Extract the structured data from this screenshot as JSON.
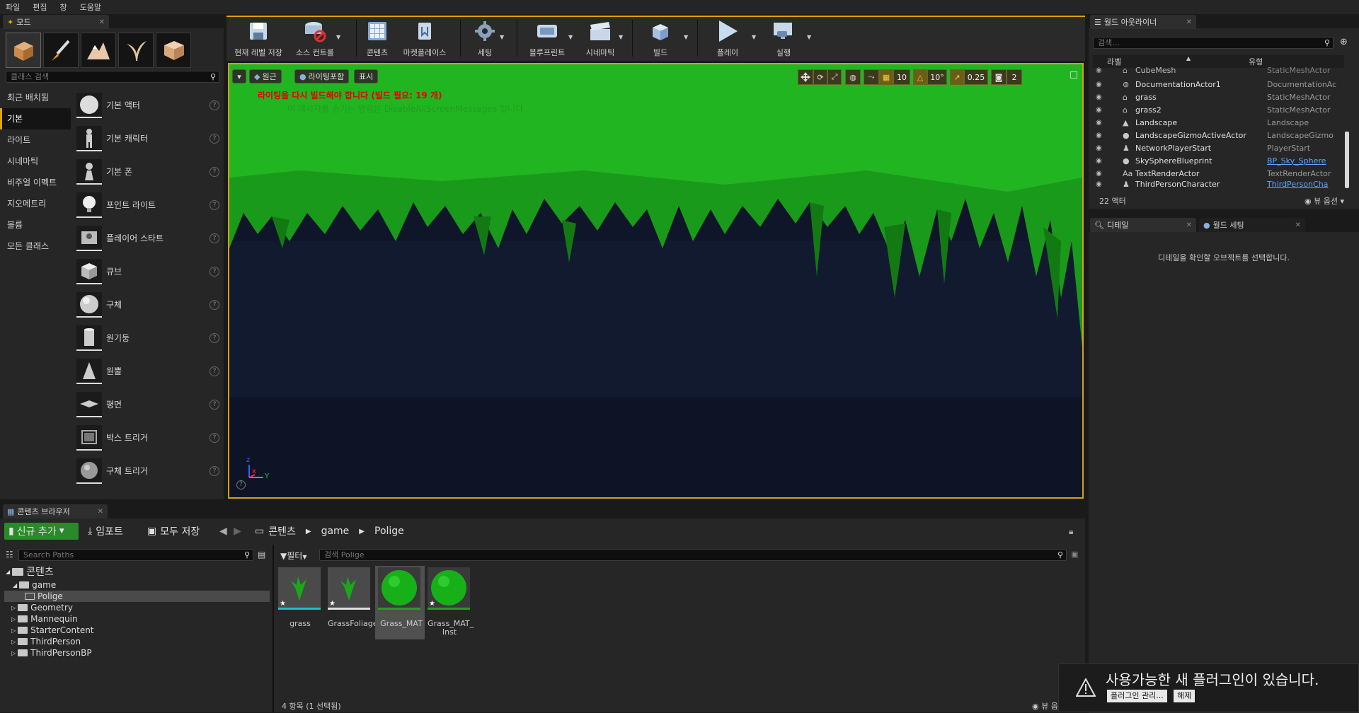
{
  "menu": [
    "파일",
    "편집",
    "창",
    "도움말"
  ],
  "modes": {
    "tab_title": "모드",
    "search_placeholder": "클래스 검색",
    "categories": [
      "최근 배치됨",
      "기본",
      "라이트",
      "시네마틱",
      "비주얼 이펙트",
      "지오메트리",
      "볼륨",
      "모든 클래스"
    ],
    "items": [
      "기본 액터",
      "기본 캐릭터",
      "기본 폰",
      "포인트 라이트",
      "플레이어 스타트",
      "큐브",
      "구체",
      "원기둥",
      "원뿔",
      "평면",
      "박스 트리거",
      "구체 트리거"
    ],
    "help_glyph": "?"
  },
  "toolbar": {
    "save": "현재 레벨 저장",
    "source_control": "소스 컨트롤",
    "content": "콘텐츠",
    "marketplace": "마켓플레이스",
    "settings": "세팅",
    "blueprint": "블루프린트",
    "cinematic": "시네마틱",
    "build": "빌드",
    "play": "플레이",
    "launch": "실행"
  },
  "viewport": {
    "perspective": "원근",
    "lighting": "라이팅포함",
    "show": "표시",
    "warning": "라이팅을 다시 빌드해야 합니다 (빌드 필요: 19 개)",
    "sub_warning": "이 메시지를 숨기는 명령은 DisableAllScreenMessages 입니다.",
    "grid_snap": "10",
    "rot_snap": "10°",
    "scale_snap": "0.25",
    "camera_speed": "2",
    "axis_x": "x",
    "axis_y": "Y",
    "axis_z": "z"
  },
  "outliner": {
    "tab_title": "월드 아웃라이너",
    "search_placeholder": "검색...",
    "col_label": "라벨",
    "col_type": "유형",
    "rows": [
      {
        "name": "CubeMesh",
        "type": "StaticMeshActor"
      },
      {
        "name": "DocumentationActor1",
        "type": "DocumentationAc"
      },
      {
        "name": "grass",
        "type": "StaticMeshActor"
      },
      {
        "name": "grass2",
        "type": "StaticMeshActor"
      },
      {
        "name": "Landscape",
        "type": "Landscape"
      },
      {
        "name": "LandscapeGizmoActiveActor",
        "type": "LandscapeGizmo"
      },
      {
        "name": "NetworkPlayerStart",
        "type": "PlayerStart"
      },
      {
        "name": "SkySphereBlueprint",
        "type": "BP_Sky_Sphere"
      },
      {
        "name": "TextRenderActor",
        "type": "TextRenderActor"
      },
      {
        "name": "ThirdPersonCharacter",
        "type": "ThirdPersonCha"
      }
    ],
    "count": "22 액터",
    "view_options": "뷰 옵션"
  },
  "details": {
    "tab_details": "디테일",
    "tab_world": "월드 세팅",
    "empty": "디테일을 확인할 오브젝트를 선택합니다."
  },
  "content_browser": {
    "tab_title": "콘텐츠 브라우저",
    "add_new": "신규 추가",
    "import": "임포트",
    "save_all": "모두 저장",
    "path": [
      "콘텐츠",
      "game",
      "Polige"
    ],
    "search_paths": "Search Paths",
    "filter": "필터",
    "search_assets": "검색 Polige",
    "tree_root": "콘텐츠",
    "tree": [
      "game",
      "Polige",
      "Geometry",
      "Mannequin",
      "StarterContent",
      "ThirdPerson",
      "ThirdPersonBP"
    ],
    "assets": [
      "grass",
      "GrassFoliage",
      "Grass_MAT",
      "Grass_MAT_ Inst"
    ],
    "status": "4 항목 (1 선택됨)",
    "view_options": "뷰 옵션"
  },
  "notification": {
    "text": "사용가능한 새 플러그인이 있습니다.",
    "manage": "플러그인 관리...",
    "dismiss": "해제"
  },
  "colors": {
    "accent": "#e0a400",
    "grass": "#1aa81a",
    "sky": "#0f1629",
    "selection": "#1ec3c3"
  }
}
